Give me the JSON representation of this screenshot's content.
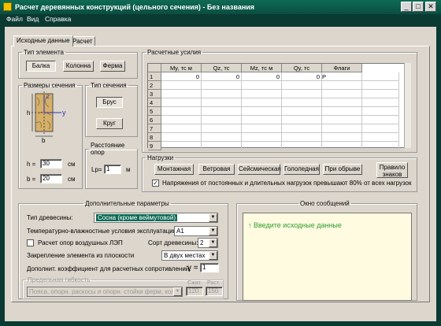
{
  "window": {
    "title": "Расчет деревянных конструкций (цельного сечения) - Без названия",
    "min": "_",
    "max": "□",
    "close": "✕"
  },
  "menu": [
    "Файл",
    "Вид",
    "Справка"
  ],
  "tabs": [
    "Исходные данные",
    "Расчет"
  ],
  "element_type": {
    "legend": "Тип элемента",
    "buttons": [
      "Балка",
      "Колонна",
      "Ферма"
    ]
  },
  "section_sizes": {
    "legend": "Размеры сечения",
    "h_label": "h =",
    "h_value": "30",
    "h_unit": "см",
    "b_label": "b =",
    "b_value": "20",
    "b_unit": "см",
    "fig_h": "h",
    "fig_b": "b",
    "fig_z": "z",
    "fig_y": "y"
  },
  "section_type": {
    "legend": "Тип сечения",
    "buttons": [
      "Брус",
      "Круг"
    ]
  },
  "support_distance": {
    "legend": "Расстояние опор",
    "label": "Lp=",
    "value": "1",
    "unit": "м"
  },
  "forces": {
    "legend": "Расчетные усилия",
    "columns": [
      "My, тс м",
      "Qz, тс",
      "Mz, тс м",
      "Qy, тс",
      "Флаги"
    ],
    "rows": [
      "1",
      "2",
      "3",
      "4",
      "5",
      "6",
      "7",
      "8",
      "9"
    ],
    "row1": [
      "0",
      "0",
      "0",
      "0",
      "P"
    ]
  },
  "loads": {
    "legend": "Нагрузки",
    "buttons": [
      "Монтажная",
      "Ветровая",
      "Сейсмическая",
      "Гололедная",
      "При обрыве"
    ],
    "button_two_line": [
      "Правило",
      "знаков"
    ],
    "checkbox_label": "Напряжения от постоянных и длительных нагрузок превышают 80% от всех нагрузок",
    "checkbox_mark": "✓"
  },
  "extra": {
    "legend": "Дополнительные параметры",
    "wood_type_label": "Тип древесины:",
    "wood_type_value": "Сосна (кроме веймутовой)",
    "humidity_label": "Температурно-влажностные условия эксплуатации:",
    "humidity_value": "А1",
    "power_line_label": "Расчет опор воздушных ЛЭП",
    "grade_label": "Сорт древесины:",
    "grade_value": "2",
    "fixing_label": "Закрепление элемента из плоскости",
    "fixing_value": "В двух местах",
    "coef_label": "Дополнит. коэффициент для расчетных сопротивлений:",
    "coef_symbol": "γ =",
    "coef_value": "1"
  },
  "slenderness": {
    "legend": "Предельная гибкость",
    "value": "Пояса, опорн. раскосы и опорн. стойки ферм, колонны",
    "compr_label": "Сжат.",
    "compr_value": "120",
    "tens_label": "Раст.",
    "tens_value": "150"
  },
  "messages": {
    "legend": "Окно сообщений",
    "text": "↑ Введите исходные данные",
    "color": "#2e9c2e"
  }
}
